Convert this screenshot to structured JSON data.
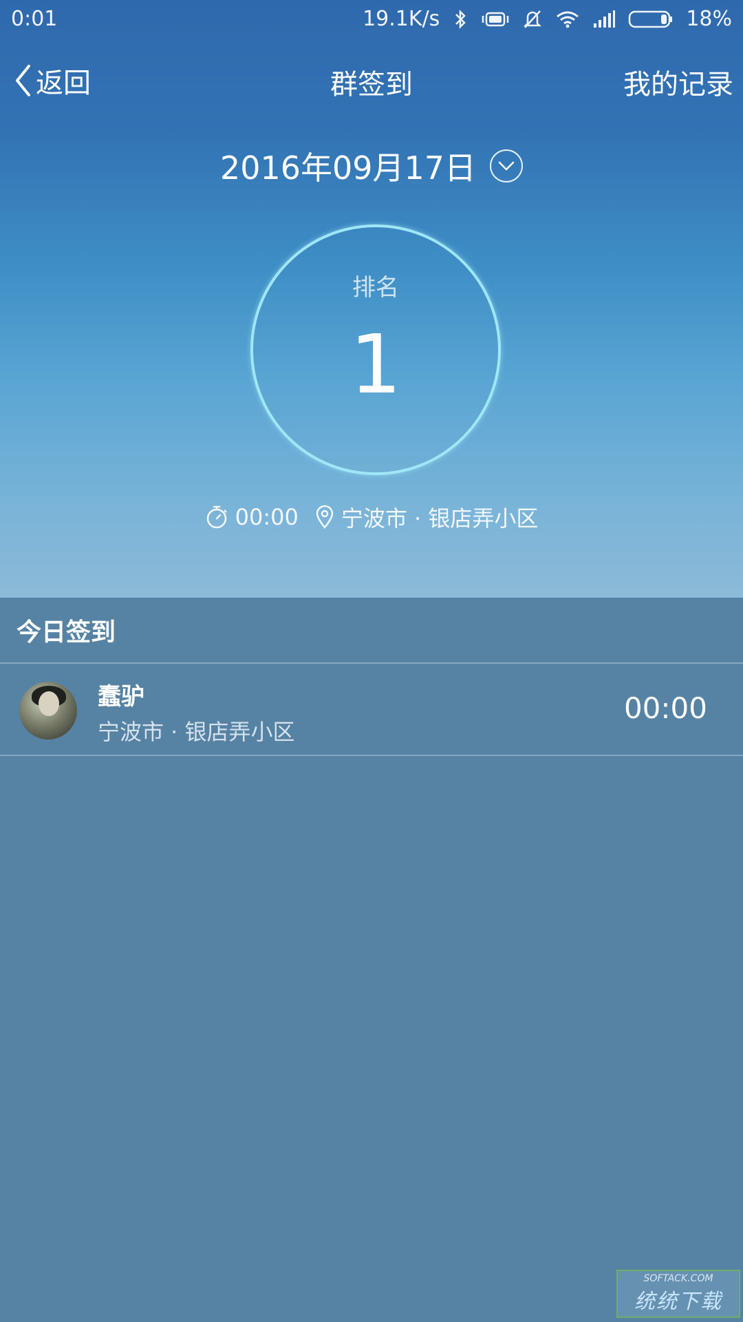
{
  "status_bar": {
    "time": "0:01",
    "speed": "19.1K/s",
    "battery": "18%",
    "icons": [
      "bluetooth-icon",
      "vibrate-icon",
      "mute-bell-icon",
      "wifi-icon",
      "signal-icon",
      "battery-icon"
    ]
  },
  "nav": {
    "back_label": "返回",
    "title": "群签到",
    "records_label": "我的记录"
  },
  "date": {
    "label": "2016年09月17日"
  },
  "rank": {
    "label": "排名",
    "value": "1"
  },
  "meta": {
    "time": "00:00",
    "location": "宁波市 · 银店弄小区"
  },
  "list": {
    "header": "今日签到",
    "items": [
      {
        "name": "蠢驴",
        "location": "宁波市 · 银店弄小区",
        "time": "00:00"
      }
    ]
  },
  "watermark": {
    "domain": "SOFTACK.COM",
    "brand": "统统下载"
  },
  "colors": {
    "hero_top": "#2f69ad",
    "hero_bottom": "#8cbad8",
    "list_bg": "#5682a4",
    "ring": "#9fe7f7"
  }
}
